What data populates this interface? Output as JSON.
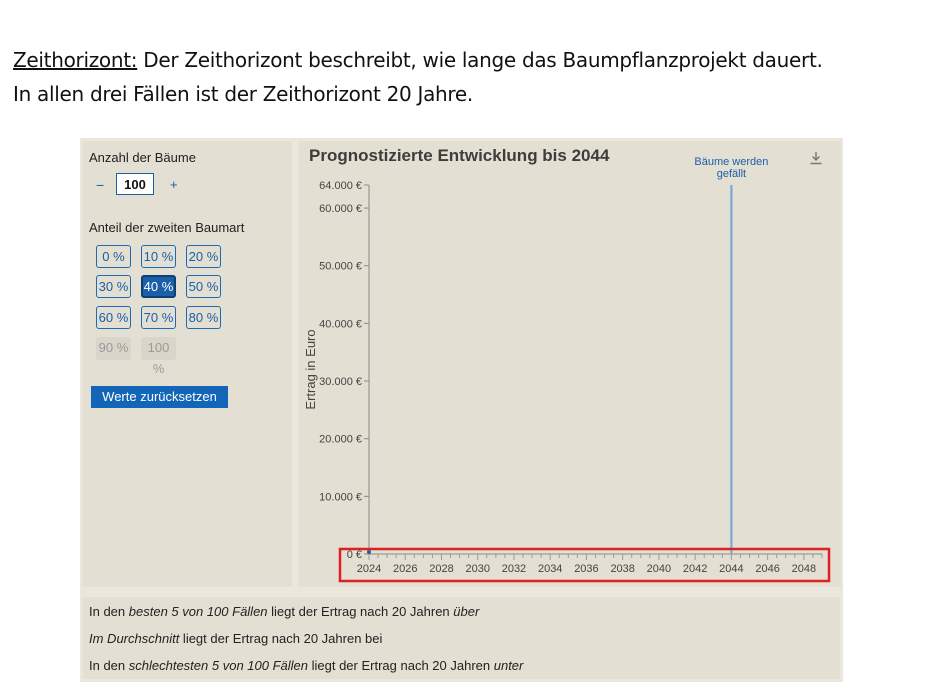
{
  "slide": {
    "line1_term": "Zeithorizont:",
    "line1_rest": " Der Zeithorizont beschreibt, wie lange das Baumpflanzprojekt dauert.",
    "line2": "In allen drei Fällen ist der Zeithorizont 20 Jahre."
  },
  "controls": {
    "trees_label": "Anzahl der Bäume",
    "minus": "−",
    "trees_value": "100",
    "plus": "+",
    "share_label": "Anteil der zweiten Baumart",
    "percent_options": [
      {
        "label": "0 %",
        "state": "normal"
      },
      {
        "label": "10 %",
        "state": "normal"
      },
      {
        "label": "20 %",
        "state": "normal"
      },
      {
        "label": "30 %",
        "state": "normal"
      },
      {
        "label": "40 %",
        "state": "active"
      },
      {
        "label": "50 %",
        "state": "normal"
      },
      {
        "label": "60 %",
        "state": "normal"
      },
      {
        "label": "70 %",
        "state": "normal"
      },
      {
        "label": "80 %",
        "state": "normal"
      },
      {
        "label": "90 %",
        "state": "disabled"
      },
      {
        "label": "100 %",
        "state": "disabled"
      }
    ],
    "reset_label": "Werte zurücksetzen"
  },
  "icons": {
    "download": "download-icon"
  },
  "chart_data": {
    "type": "line",
    "title": "Prognostizierte Entwicklung bis 2044",
    "ylabel": "Ertrag in Euro",
    "xlabel": "",
    "x_ticks": [
      "2024",
      "2026",
      "2028",
      "2030",
      "2032",
      "2034",
      "2036",
      "2038",
      "2040",
      "2042",
      "2044",
      "2046",
      "2048"
    ],
    "xlim": [
      2024,
      2049
    ],
    "y_ticks": [
      {
        "value": 0,
        "label": "0 €"
      },
      {
        "value": 10000,
        "label": "10.000 €"
      },
      {
        "value": 20000,
        "label": "20.000 €"
      },
      {
        "value": 30000,
        "label": "30.000 €"
      },
      {
        "value": 40000,
        "label": "40.000 €"
      },
      {
        "value": 50000,
        "label": "50.000 €"
      },
      {
        "value": 60000,
        "label": "60.000 €"
      },
      {
        "value": 64000,
        "label": "64.000 €"
      }
    ],
    "ylim": [
      0,
      64000
    ],
    "annotation": {
      "x": 2044,
      "text_line1": "Bäume werden",
      "text_line2": "gefällt"
    },
    "harvest_band": {
      "x": 2044,
      "y_from": 0,
      "y_to": 64000
    },
    "highlight_color": "#e02020",
    "accent_color": "#1b5fa8"
  },
  "summary": {
    "l1_a": "In den ",
    "l1_b": "besten 5 von 100 Fällen",
    "l1_c": " liegt der Ertrag nach 20 Jahren ",
    "l1_d": "über",
    "l2_a": "Im Durchschnitt",
    "l2_b": " liegt der Ertrag nach 20 Jahren bei",
    "l3_a": "In den ",
    "l3_b": "schlechtesten 5 von 100 Fällen",
    "l3_c": " liegt der Ertrag nach 20 Jahren ",
    "l3_d": "unter"
  }
}
